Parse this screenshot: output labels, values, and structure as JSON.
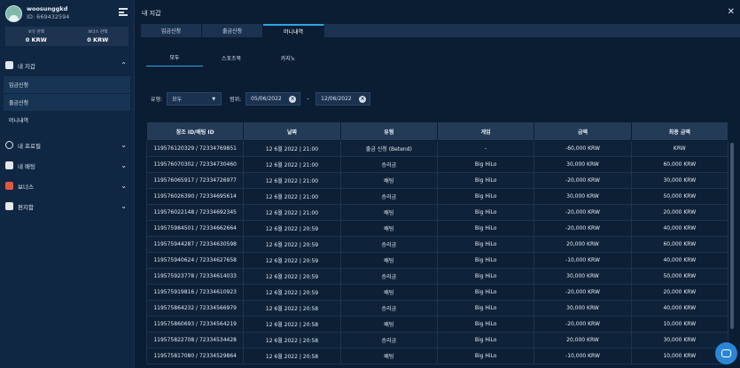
{
  "user": {
    "name": "woosunggkd",
    "id": "ID: 669432594"
  },
  "balances": [
    {
      "label": "보유 잔액",
      "value": "0 KRW"
    },
    {
      "label": "보너스 잔액",
      "value": "0 KRW"
    }
  ],
  "nav": {
    "wallet": "내 지갑",
    "wallet_items": [
      "입금신청",
      "출금신청",
      "머니내역"
    ],
    "profile": "내 프로필",
    "betting": "내 배팅",
    "bonus": "보너스",
    "mailbox": "편지함"
  },
  "header": {
    "title": "내 지갑",
    "close": "✕"
  },
  "tabs": [
    "입금신청",
    "출금신청",
    "머니내역"
  ],
  "subtabs": [
    "모두",
    "스포츠북",
    "카지노"
  ],
  "filters": {
    "type_label": "유형:",
    "type_value": "모두",
    "range_label": "범위:",
    "date_from": "05/06/2022",
    "date_to": "12/06/2022",
    "separator": "–"
  },
  "table": {
    "headers": [
      "참조 ID/배팅 ID",
      "날짜",
      "유형",
      "게임",
      "금액",
      "최종 금액"
    ],
    "rows": [
      [
        "119576120329 / 72334769851",
        "12 6월 2022 | 21:00",
        "출금 신청 (Betend)",
        "-",
        "-60,000 KRW",
        "KRW"
      ],
      [
        "119576070302 / 72334730460",
        "12 6월 2022 | 21:00",
        "승리금",
        "Big HiLo",
        "30,000 KRW",
        "60,000 KRW"
      ],
      [
        "119576065917 / 72334726977",
        "12 6월 2022 | 21:00",
        "배팅",
        "Big HiLo",
        "-20,000 KRW",
        "30,000 KRW"
      ],
      [
        "119576026390 / 72334695614",
        "12 6월 2022 | 21:00",
        "승리금",
        "Big HiLo",
        "30,000 KRW",
        "50,000 KRW"
      ],
      [
        "119576022148 / 72334692345",
        "12 6월 2022 | 21:00",
        "배팅",
        "Big HiLo",
        "-20,000 KRW",
        "20,000 KRW"
      ],
      [
        "119575984501 / 72334662664",
        "12 6월 2022 | 20:59",
        "배팅",
        "Big HiLo",
        "-20,000 KRW",
        "40,000 KRW"
      ],
      [
        "119575944287 / 72334630598",
        "12 6월 2022 | 20:59",
        "승리금",
        "Big HiLo",
        "20,000 KRW",
        "60,000 KRW"
      ],
      [
        "119575940624 / 72334627658",
        "12 6월 2022 | 20:59",
        "배팅",
        "Big HiLo",
        "-10,000 KRW",
        "40,000 KRW"
      ],
      [
        "119575923778 / 72334614033",
        "12 6월 2022 | 20:59",
        "승리금",
        "Big HiLo",
        "30,000 KRW",
        "50,000 KRW"
      ],
      [
        "119575919816 / 72334610923",
        "12 6월 2022 | 20:59",
        "배팅",
        "Big HiLo",
        "-20,000 KRW",
        "20,000 KRW"
      ],
      [
        "119575864232 / 72334566979",
        "12 6월 2022 | 20:58",
        "승리금",
        "Big HiLo",
        "30,000 KRW",
        "40,000 KRW"
      ],
      [
        "119575860693 / 72334564219",
        "12 6월 2022 | 20:58",
        "배팅",
        "Big HiLo",
        "-20,000 KRW",
        "10,000 KRW"
      ],
      [
        "119575822708 / 72334534428",
        "12 6월 2022 | 20:58",
        "승리금",
        "Big HiLo",
        "20,000 KRW",
        "30,000 KRW"
      ],
      [
        "119575817080 / 72334529864",
        "12 6월 2022 | 20:58",
        "배팅",
        "Big HiLo",
        "-10,000 KRW",
        "10,000 KRW"
      ]
    ]
  },
  "colors": {
    "accent": "#2ea3e6",
    "background": "#0b1d33",
    "sidebar": "#0f2742"
  }
}
